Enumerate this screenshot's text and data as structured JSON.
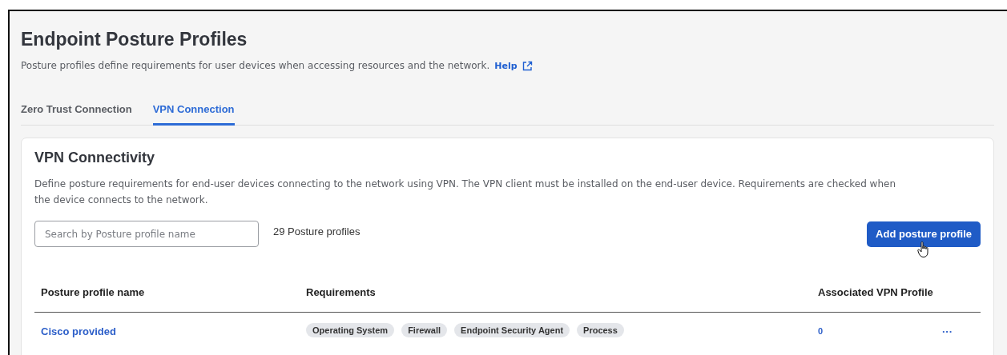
{
  "page": {
    "title": "Endpoint Posture Profiles",
    "description": "Posture profiles define requirements for user devices when accessing resources and the network.",
    "help_link": "Help"
  },
  "tabs": [
    {
      "label": "Zero Trust Connection",
      "selected": false
    },
    {
      "label": "VPN Connection",
      "selected": true
    }
  ],
  "card": {
    "title": "VPN Connectivity",
    "description": "Define posture requirements for end-user devices connecting to the network using VPN. The VPN client must be installed on the end-user device. Requirements are checked when the device connects to the network.",
    "search": {
      "placeholder": "Search by Posture profile name"
    },
    "count": "29 Posture profiles",
    "add_button": "Add posture profile"
  },
  "table": {
    "columns": [
      "Posture profile name",
      "Requirements",
      "Associated VPN Profile"
    ],
    "rows": [
      {
        "name": "Cisco provided",
        "requirements": [
          "Operating System",
          "Firewall",
          "Endpoint Security Agent",
          "Process"
        ],
        "associated": "0",
        "menu": "···"
      }
    ]
  }
}
